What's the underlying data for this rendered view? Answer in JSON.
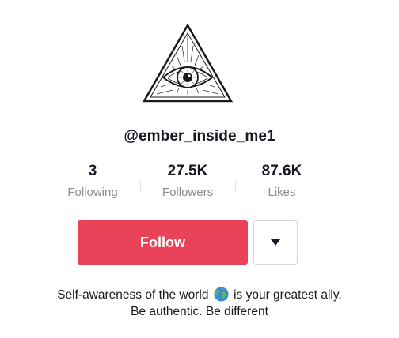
{
  "profile": {
    "avatar_icon": "all-seeing-eye-triangle-icon",
    "handle": "@ember_inside_me1"
  },
  "stats": {
    "following": {
      "value": "3",
      "label": "Following"
    },
    "followers": {
      "value": "27.5K",
      "label": "Followers"
    },
    "likes": {
      "value": "87.6K",
      "label": "Likes"
    }
  },
  "actions": {
    "follow_label": "Follow",
    "more_icon": "caret-down-icon"
  },
  "bio": {
    "line1_before": "Self-awareness of the world",
    "line1_emoji_icon": "globe-icon",
    "line1_after": "is your greatest ally.",
    "line2": "Be authentic. Be different"
  },
  "colors": {
    "follow_button": "#ea4359",
    "secondary_text": "#8a8b91",
    "primary_text": "#161823"
  }
}
